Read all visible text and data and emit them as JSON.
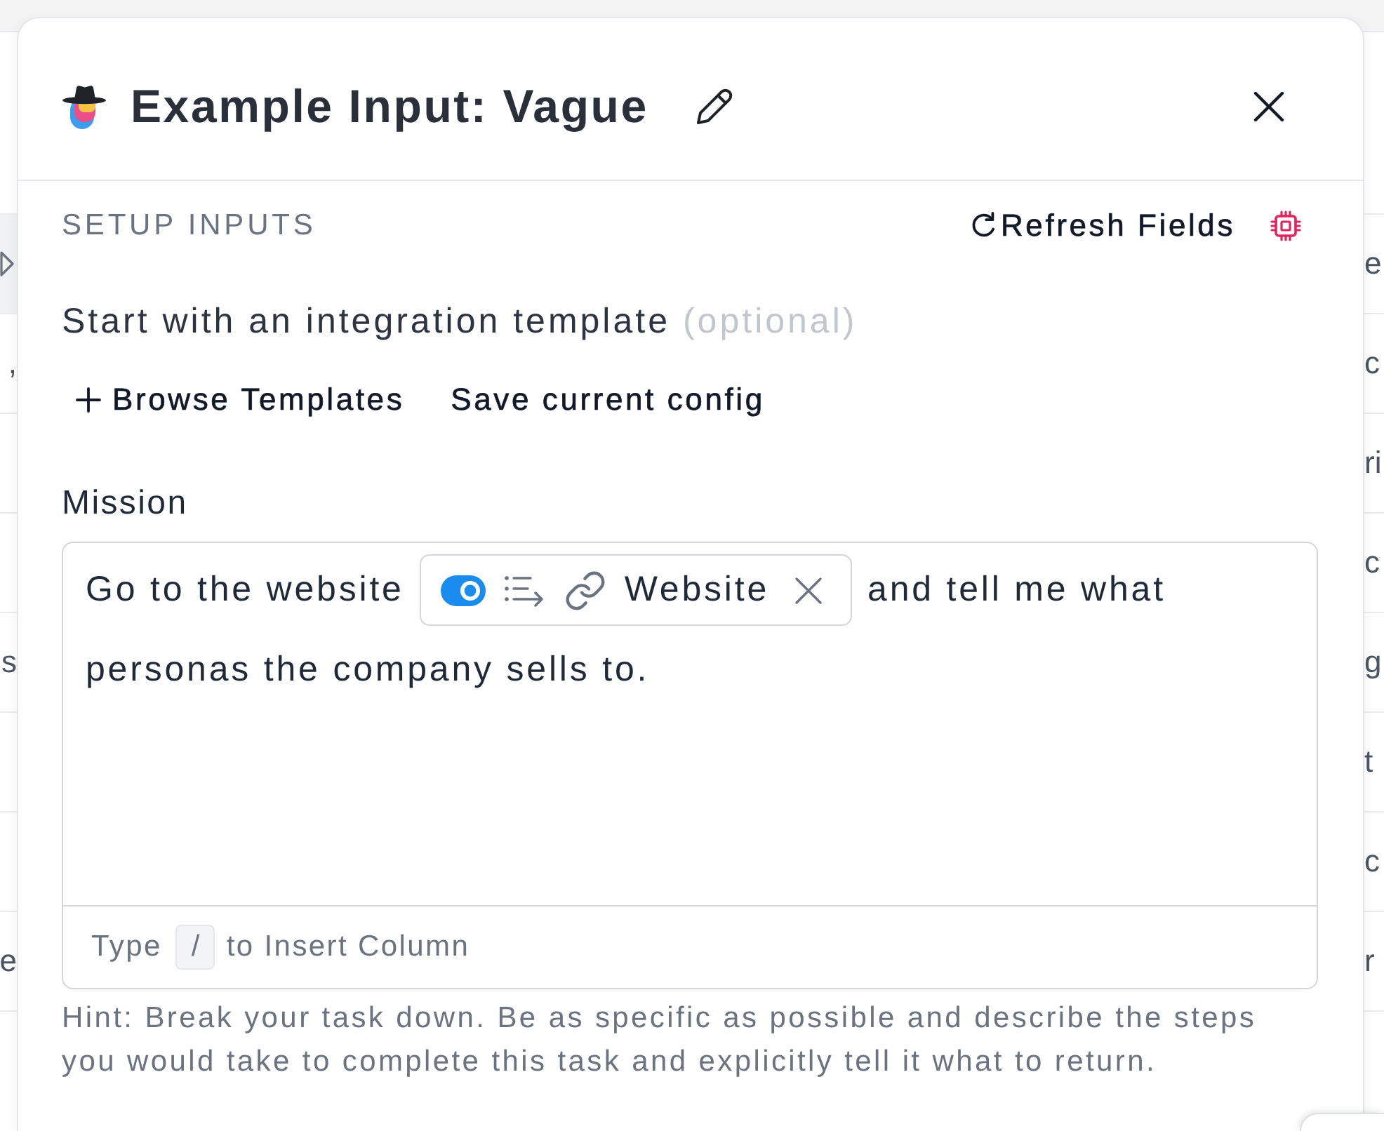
{
  "background_table": {
    "rows": [
      {
        "kind": "icon",
        "highlighted": true,
        "right": "e"
      },
      {
        "kind": "text",
        "highlighted": false,
        "left": ",",
        "right": "c"
      },
      {
        "kind": "text",
        "highlighted": false,
        "right": "ri"
      },
      {
        "kind": "text",
        "highlighted": false,
        "right": "c"
      },
      {
        "kind": "text",
        "highlighted": false,
        "left": "s",
        "right": "g"
      },
      {
        "kind": "text",
        "highlighted": false,
        "right": "t"
      },
      {
        "kind": "text",
        "highlighted": false,
        "right": "c"
      },
      {
        "kind": "text",
        "highlighted": false,
        "left": "e",
        "right": "r"
      }
    ]
  },
  "dialog": {
    "title": "Example Input: Vague",
    "section": {
      "title": "SETUP INPUTS",
      "refresh": "Refresh Fields"
    },
    "template": {
      "label": "Start with an integration template",
      "note": "(optional)",
      "actions": [
        {
          "kind": "browse",
          "label": "Browse Templates"
        },
        {
          "kind": "save",
          "label": "Save current config"
        }
      ]
    },
    "mission": {
      "label": "Mission",
      "lines": [
        [
          {
            "kind": "text",
            "text": "Go to the website"
          },
          {
            "kind": "chip",
            "on": true,
            "label": "Website"
          },
          {
            "kind": "text",
            "text": "and tell me what"
          }
        ],
        [
          {
            "kind": "text",
            "text": "personas the company sells to."
          }
        ]
      ],
      "footer": {
        "before": "Type",
        "key": "/",
        "after": "to Insert Column"
      }
    },
    "hint": "Hint: Break your task down. Be as specific as possible and describe the steps you would take to complete this task and explicitly tell it what to return."
  }
}
